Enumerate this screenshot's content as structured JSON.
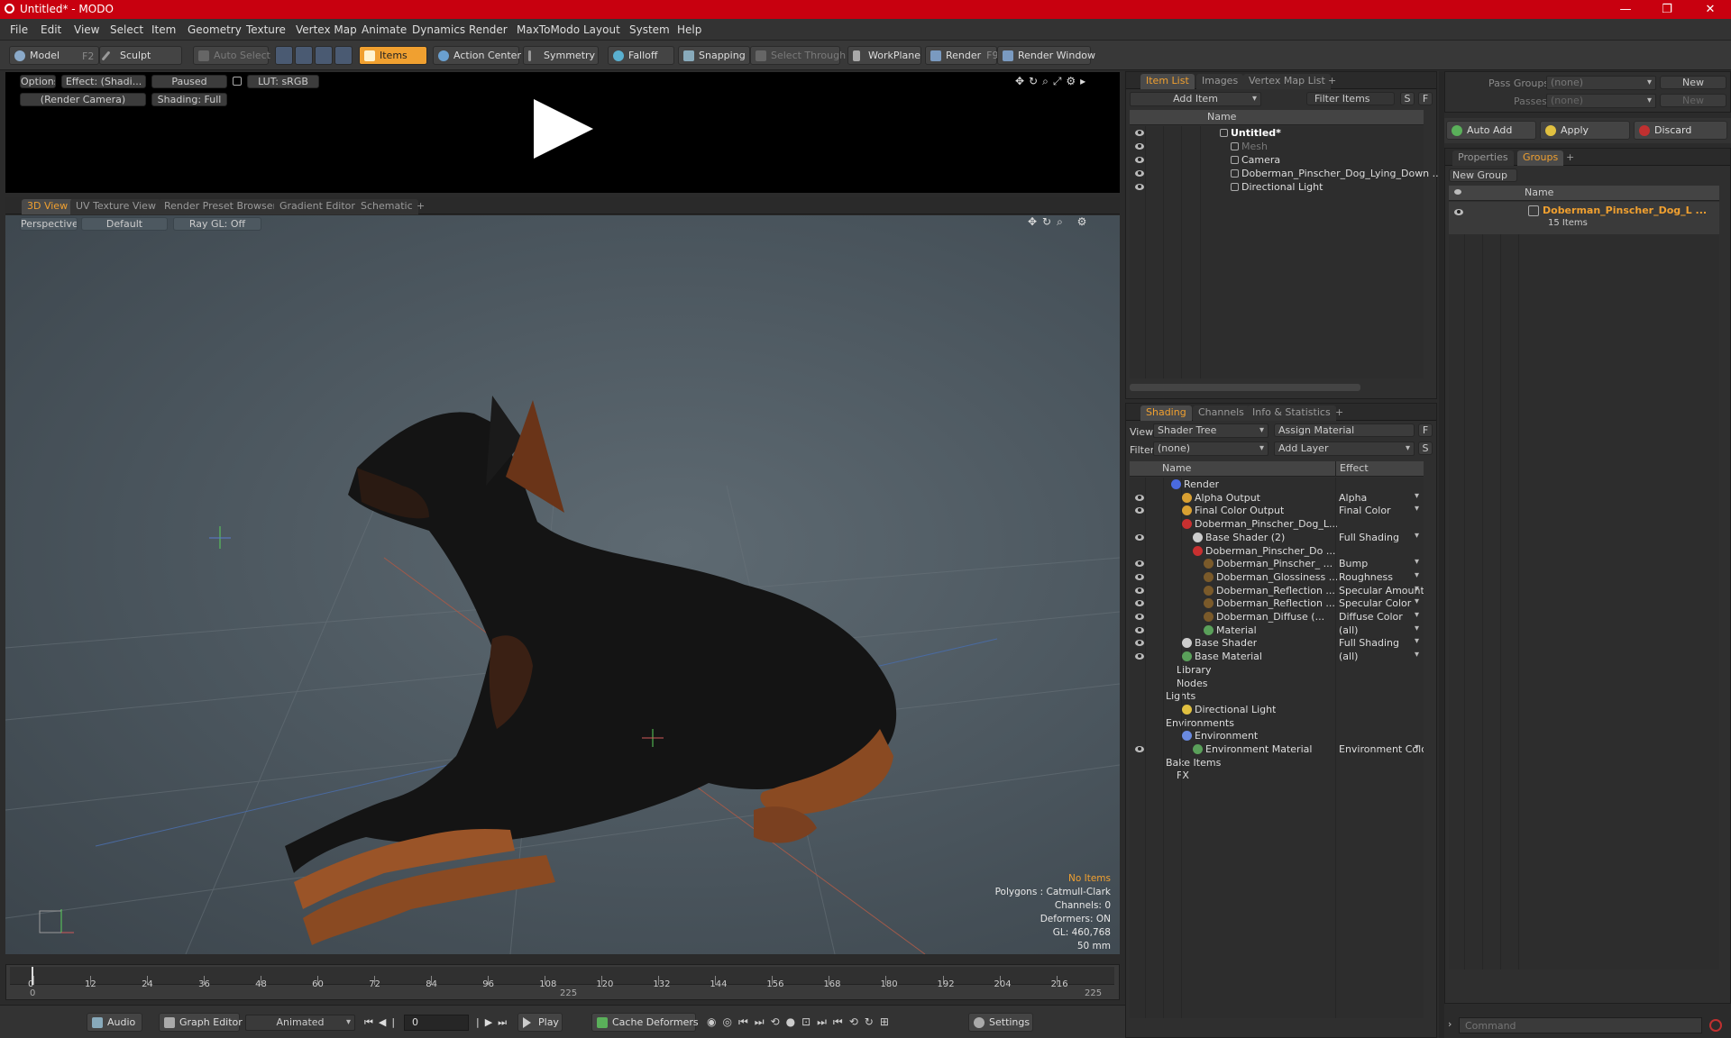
{
  "window": {
    "title": "Untitled* - MODO",
    "minimize": "—",
    "maximize": "❐",
    "close": "✕"
  },
  "menu": [
    "File",
    "Edit",
    "View",
    "Select",
    "Item",
    "Geometry",
    "Texture",
    "Vertex Map",
    "Animate",
    "Dynamics",
    "Render",
    "MaxToModo",
    "Layout",
    "System",
    "Help"
  ],
  "toolbar": {
    "model": "Model",
    "model_hotkey": "F2",
    "sculpt": "Sculpt",
    "auto_select": "Auto Select",
    "items": "Items",
    "action_center": "Action Center",
    "symmetry": "Symmetry",
    "falloff": "Falloff",
    "snapping": "Snapping",
    "select_through": "Select Through",
    "workplane": "WorkPlane",
    "render": "Render",
    "render_hotkey": "F9",
    "render_window": "Render Window"
  },
  "preview": {
    "options": "Options",
    "effect": "Effect: (Shadi...",
    "paused": "Paused",
    "lut": "LUT: sRGB",
    "camera": "(Render Camera)",
    "shading": "Shading: Full"
  },
  "view_tabs": [
    "3D View",
    "UV Texture View",
    "Render Preset Browser",
    "Gradient Editor",
    "Schematic",
    "+"
  ],
  "viewport": {
    "perspective": "Perspective",
    "default": "Default",
    "raygl": "Ray GL: Off",
    "info": [
      "No Items",
      "Polygons : Catmull-Clark",
      "Channels: 0",
      "Deformers: ON",
      "GL: 460,768",
      "50 mm"
    ]
  },
  "timeline": {
    "ticks": [
      "0",
      "12",
      "24",
      "36",
      "48",
      "60",
      "72",
      "84",
      "96",
      "108",
      "120",
      "132",
      "144",
      "156",
      "168",
      "180",
      "192",
      "204",
      "216"
    ],
    "start": "0",
    "mid": "225",
    "end": "225"
  },
  "bottom": {
    "audio": "Audio",
    "graph_editor": "Graph Editor",
    "animated": "Animated",
    "frame": "0",
    "play": "Play",
    "cache": "Cache Deformers",
    "settings": "Settings"
  },
  "itemlist": {
    "tabs": [
      "Item List",
      "Images",
      "Vertex Map List",
      "+"
    ],
    "add_item": "Add Item",
    "filter": "Filter Items",
    "s": "S",
    "f": "F",
    "col_name": "Name",
    "rows": [
      {
        "label": "Untitled*",
        "indent": 0
      },
      {
        "label": "Mesh",
        "indent": 1
      },
      {
        "label": "Camera",
        "indent": 1
      },
      {
        "label": "Doberman_Pinscher_Dog_Lying_Down ...",
        "indent": 1
      },
      {
        "label": "Directional Light",
        "indent": 1
      }
    ]
  },
  "shading": {
    "tabs": [
      "Shading",
      "Channels",
      "Info & Statistics",
      "+"
    ],
    "view_label": "View",
    "view_value": "Shader Tree",
    "assign": "Assign Material",
    "filter_label": "Filter",
    "filter_value": "(none)",
    "add_layer": "Add Layer",
    "f": "F",
    "s": "S",
    "col_name": "Name",
    "col_effect": "Effect",
    "rows": [
      {
        "label": "Render",
        "effect": "",
        "indent": 0,
        "color": "#4a6adf"
      },
      {
        "label": "Alpha Output",
        "effect": "Alpha",
        "indent": 1,
        "color": "#d9a032"
      },
      {
        "label": "Final Color Output",
        "effect": "Final Color",
        "indent": 1,
        "color": "#d9a032"
      },
      {
        "label": "Doberman_Pinscher_Dog_L...",
        "effect": "",
        "indent": 1,
        "color": "#c83030"
      },
      {
        "label": "Base Shader (2)",
        "effect": "Full Shading",
        "indent": 2,
        "color": "#cccccc"
      },
      {
        "label": "Doberman_Pinscher_Do ...",
        "effect": "",
        "indent": 2,
        "color": "#c83030"
      },
      {
        "label": "Doberman_Pinscher_ ...",
        "effect": "Bump",
        "indent": 3,
        "color": "#7a5a2a"
      },
      {
        "label": "Doberman_Glossiness ...",
        "effect": "Roughness",
        "indent": 3,
        "color": "#7a5a2a"
      },
      {
        "label": "Doberman_Reflection ...",
        "effect": "Specular Amount",
        "indent": 3,
        "color": "#7a5a2a"
      },
      {
        "label": "Doberman_Reflection ...",
        "effect": "Specular Color",
        "indent": 3,
        "color": "#7a5a2a"
      },
      {
        "label": "Doberman_Diffuse (...",
        "effect": "Diffuse Color",
        "indent": 3,
        "color": "#7a5a2a"
      },
      {
        "label": "Material",
        "effect": "(all)",
        "indent": 3,
        "color": "#5aa05a"
      },
      {
        "label": "Base Shader",
        "effect": "Full Shading",
        "indent": 1,
        "color": "#cccccc"
      },
      {
        "label": "Base Material",
        "effect": "(all)",
        "indent": 1,
        "color": "#5aa05a"
      },
      {
        "label": "Library",
        "effect": "",
        "indent": 1,
        "color": ""
      },
      {
        "label": "Nodes",
        "effect": "",
        "indent": 1,
        "color": ""
      },
      {
        "label": "Lights",
        "effect": "",
        "indent": 0,
        "color": ""
      },
      {
        "label": "Directional Light",
        "effect": "",
        "indent": 1,
        "color": "#e0c040"
      },
      {
        "label": "Environments",
        "effect": "",
        "indent": 0,
        "color": ""
      },
      {
        "label": "Environment",
        "effect": "",
        "indent": 1,
        "color": "#6a8adf"
      },
      {
        "label": "Environment Material",
        "effect": "Environment Color",
        "indent": 2,
        "color": "#5aa05a"
      },
      {
        "label": "Bake Items",
        "effect": "",
        "indent": 0,
        "color": ""
      },
      {
        "label": "FX",
        "effect": "",
        "indent": 1,
        "color": ""
      }
    ]
  },
  "passes": {
    "pass_groups": "Pass Groups",
    "passes": "Passes",
    "none": "(none)",
    "new": "New",
    "auto_add": "Auto Add",
    "apply": "Apply",
    "discard": "Discard"
  },
  "groups": {
    "tabs": [
      "Properties",
      "Groups",
      "+"
    ],
    "new_group": "New Group",
    "col_name": "Name",
    "group_name": "Doberman_Pinscher_Dog_L ...",
    "group_count": "15 Items"
  },
  "command": {
    "placeholder": "Command"
  }
}
